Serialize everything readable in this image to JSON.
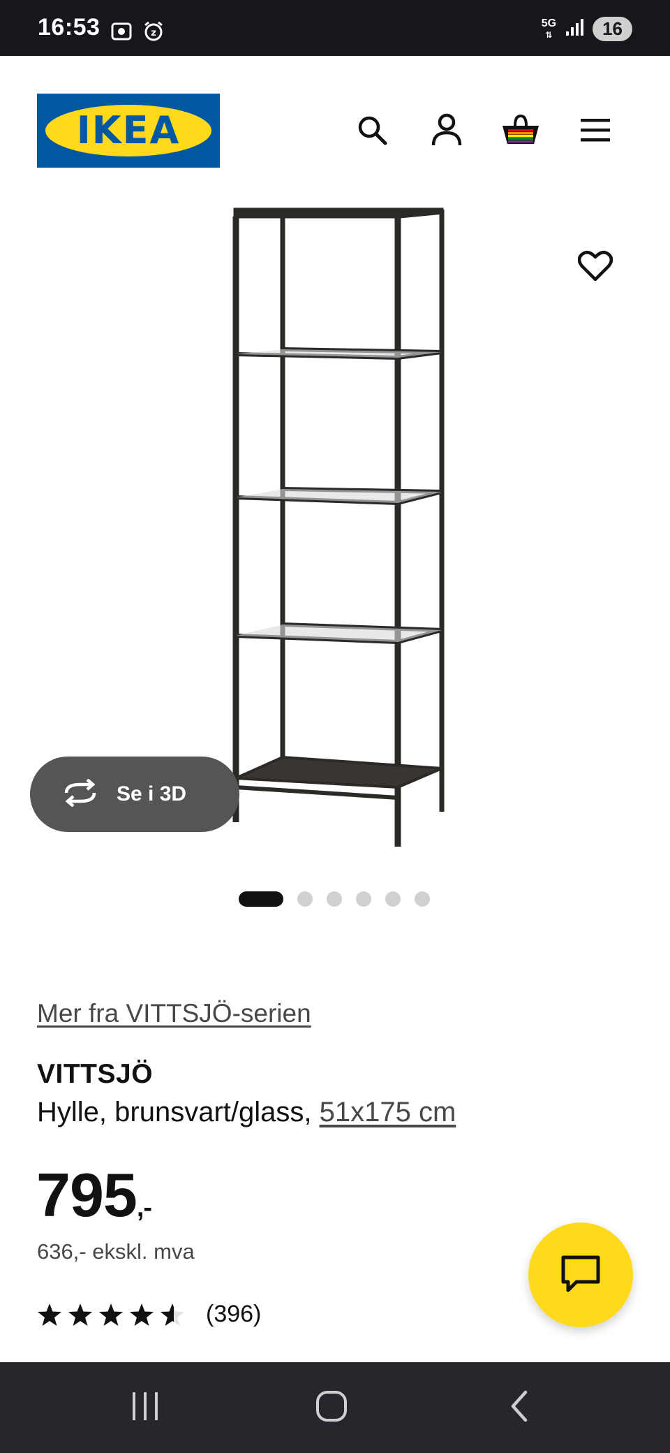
{
  "status_bar": {
    "time": "16:53",
    "network": "5G",
    "battery": "16",
    "icons": [
      "screen-record-icon",
      "alarm-icon",
      "signal-icon"
    ]
  },
  "header": {
    "logo_text": "IKEA",
    "logo_reg": "®",
    "icons": [
      "search-icon",
      "account-icon",
      "cart-icon",
      "menu-icon"
    ],
    "brand_colors": {
      "blue": "#0058a3",
      "yellow": "#ffda1a"
    }
  },
  "gallery": {
    "view_3d_label": "Se i 3D",
    "slide_count": 6,
    "active_slide": 1
  },
  "product": {
    "series_link": "Mer fra VITTSJÖ-serien",
    "name": "VITTSJÖ",
    "description": "Hylle, brunsvart/glass, ",
    "size_link": "51x175 cm",
    "price": "795",
    "price_suffix": ",-",
    "price_ex_vat": "636,- ekskl. mva",
    "rating": 4.5,
    "rating_max": 5,
    "review_count": "(396)"
  },
  "nav_bar": {
    "icons": [
      "recent-apps-icon",
      "home-icon",
      "back-icon"
    ]
  }
}
